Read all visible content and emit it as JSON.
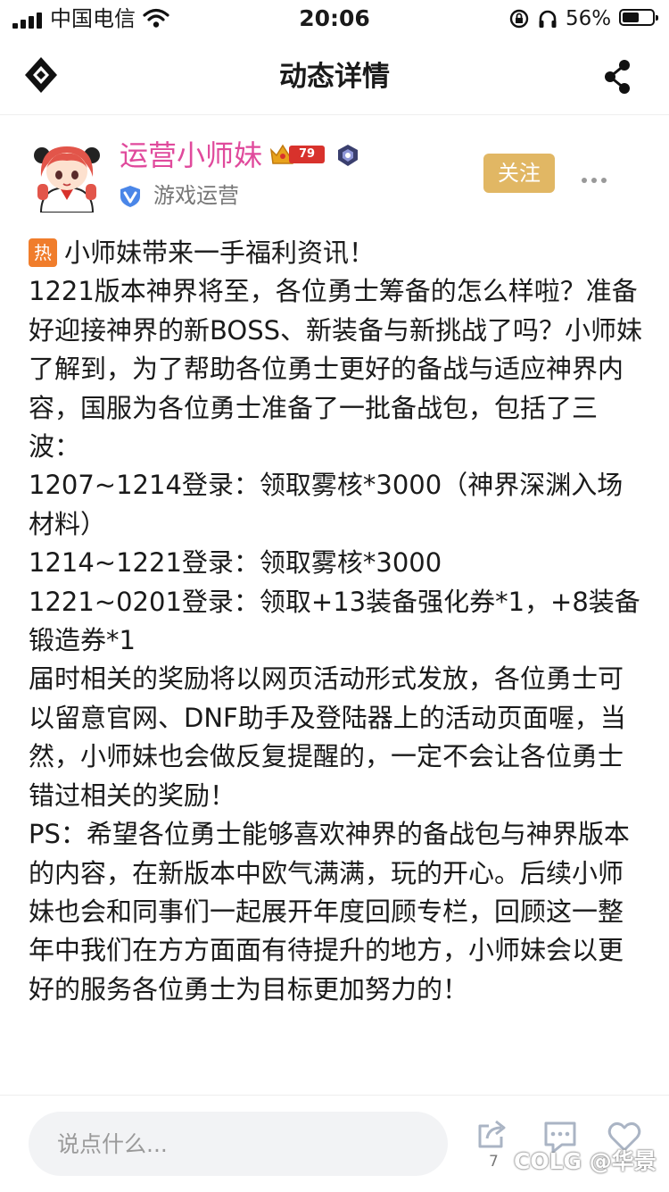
{
  "status_bar": {
    "carrier": "中国电信",
    "time": "20:06",
    "battery_percent": "56%",
    "battery_level": 0.56,
    "icons": [
      "signal-icon",
      "wifi-icon",
      "orientation-lock-icon",
      "headphone-icon",
      "battery-icon"
    ]
  },
  "header": {
    "title": "动态详情",
    "icons": [
      "logo-icon",
      "share-icon"
    ]
  },
  "author": {
    "name": "运营小师妹",
    "level": "79",
    "role": "游戏运营",
    "follow_label": "关注",
    "name_color": "#e04a9c",
    "follow_color": "#e1b764"
  },
  "post": {
    "hot_tag": "热",
    "lines": [
      "小师妹带来一手福利资讯！",
      "1221版本神界将至，各位勇士筹备的怎么样啦？准备好迎接神界的新BOSS、新装备与新挑战了吗？小师妹了解到，为了帮助各位勇士更好的备战与适应神界内容，国服为各位勇士准备了一批备战包，包括了三波：",
      "1207~1214登录：领取雾核*3000（神界深渊入场材料）",
      "1214~1221登录：领取雾核*3000",
      "1221~0201登录：领取+13装备强化券*1，+8装备锻造券*1",
      "届时相关的奖励将以网页活动形式发放，各位勇士可以留意官网、DNF助手及登陆器上的活动页面喔，当然，小师妹也会做反复提醒的，一定不会让各位勇士错过相关的奖励！",
      "PS：希望各位勇士能够喜欢神界的备战包与神界版本的内容，在新版本中欧气满满，玩的开心。后续小师妹也会和同事们一起展开年度回顾专栏，回顾这一整年中我们在方方面面有待提升的地方，小师妹会以更好的服务各位勇士为目标更加努力的！"
    ]
  },
  "bottom_bar": {
    "comment_placeholder": "说点什么...",
    "share_count": "7",
    "watermark": "COLG @华景"
  }
}
